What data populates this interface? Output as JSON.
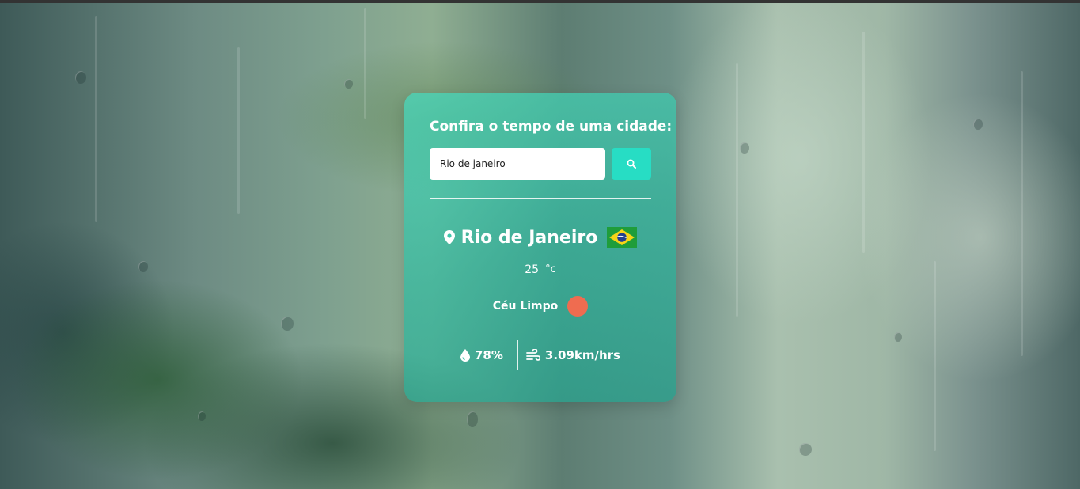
{
  "colors": {
    "card_accent": "#4ad6b9",
    "search_button": "#27ddc4",
    "weather_icon": "#ef6c50",
    "text": "#ffffff"
  },
  "form": {
    "title": "Confira o tempo de uma cidade:",
    "search_value": "Rio de janeiro",
    "search_button_icon": "search-icon"
  },
  "weather": {
    "location_icon": "map-pin-icon",
    "city": "Rio de Janeiro",
    "country_flag": "brazil-flag",
    "temperature": "25",
    "unit": "°c",
    "description": "Céu Limpo",
    "weather_icon": "clear-sky-icon",
    "humidity_icon": "droplet-icon",
    "humidity": "78%",
    "wind_icon": "wind-icon",
    "wind": "3.09km/hrs"
  }
}
